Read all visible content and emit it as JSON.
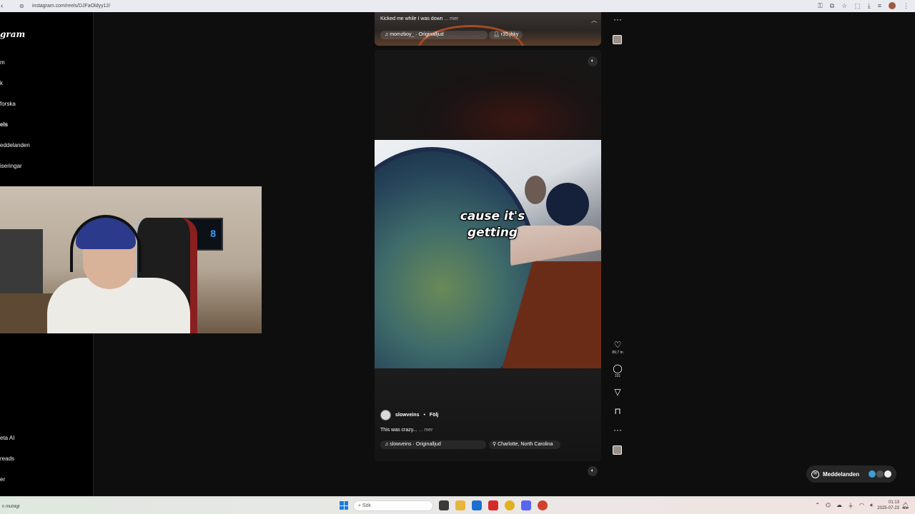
{
  "browser": {
    "url": "instagram.com/reels/DJFaOldyy12/"
  },
  "sidebar": {
    "logo": "gram",
    "items": [
      {
        "label": "m"
      },
      {
        "label": "k"
      },
      {
        "label": "forska"
      },
      {
        "label": "els"
      },
      {
        "label": "eddelanden"
      },
      {
        "label": "iseringar"
      },
      {
        "label": "eta AI"
      },
      {
        "label": "reads"
      },
      {
        "label": "er"
      }
    ]
  },
  "top_reel": {
    "caption": "Kicked me while I was down",
    "more": "... mer",
    "audio": "momzboy_ · Originalljud",
    "tagged_user": "r35.jhky"
  },
  "reel": {
    "subtitle_line1": "cause it's",
    "subtitle_line2": "getting",
    "username": "slowveins",
    "separator": "•",
    "follow": "Följ",
    "caption": "This was crazy...",
    "more": "... mer",
    "audio": "slowveins · Originalljud",
    "location": "Charlotte, North Carolina"
  },
  "actions": {
    "likes": "89,7 tn",
    "comments": "151"
  },
  "icons": {
    "back": "back-arrow-icon",
    "site_info": "site-info-icon",
    "more": "more-dots-icon",
    "mute": "speaker-icon",
    "like": "heart-icon",
    "comment": "comment-icon",
    "share": "send-icon",
    "save": "bookmark-icon",
    "music": "music-note-icon",
    "location": "location-pin-icon",
    "messenger": "messenger-icon"
  },
  "messages_pill": {
    "label": "Meddelanden"
  },
  "taskbar": {
    "weather": "n mulnigt",
    "search_placeholder": "Sök",
    "time": "01:13",
    "date": "2025-07-23"
  },
  "webcam": {
    "monitor_digit": "8"
  },
  "colors": {
    "page_bg": "#0e0e0e",
    "sidebar_bg": "#000000",
    "accent": "#1a7ce0"
  }
}
